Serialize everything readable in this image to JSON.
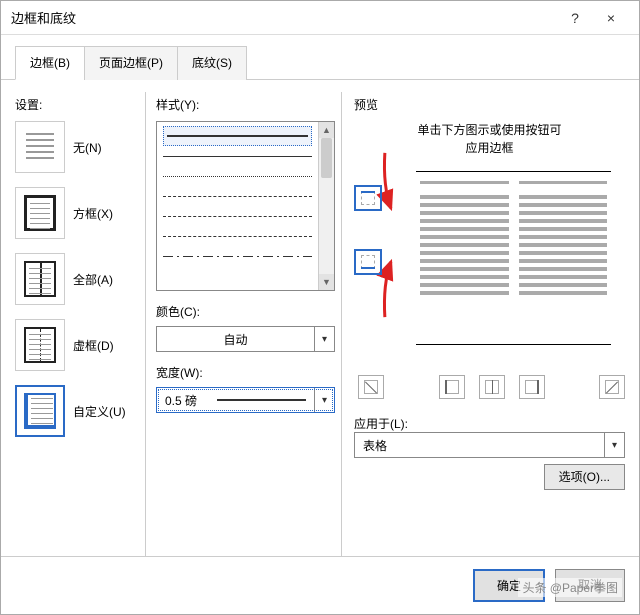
{
  "title": "边框和底纹",
  "titlebar": {
    "help": "?",
    "close": "×"
  },
  "tabs": {
    "borders": "边框(B)",
    "page_borders": "页面边框(P)",
    "shading": "底纹(S)"
  },
  "settings": {
    "label": "设置:",
    "none": "无(N)",
    "box": "方框(X)",
    "all": "全部(A)",
    "grid": "虚框(D)",
    "custom": "自定义(U)"
  },
  "style": {
    "label": "样式(Y):"
  },
  "color": {
    "label": "颜色(C):",
    "value": "自动"
  },
  "width": {
    "label": "宽度(W):",
    "value": "0.5 磅"
  },
  "preview": {
    "label": "预览",
    "hint1": "单击下方图示或使用按钮可",
    "hint2": "应用边框",
    "apply_label": "应用于(L):",
    "apply_value": "表格",
    "options": "选项(O)..."
  },
  "footer": {
    "ok": "确定",
    "cancel": "取消"
  },
  "watermark": "头条 @Paper拳图"
}
